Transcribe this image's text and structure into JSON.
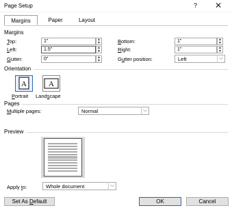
{
  "window": {
    "title": "Page Setup",
    "help": "?",
    "close": "✕"
  },
  "tabs": [
    {
      "label": "Margins",
      "accel": ""
    },
    {
      "label": "Paper"
    },
    {
      "label": "Layout"
    }
  ],
  "margins": {
    "section": "Margins",
    "top": {
      "pre": "",
      "key": "T",
      "post": "op:",
      "value": "1\""
    },
    "bottom": {
      "pre": "",
      "key": "B",
      "post": "ottom:",
      "value": "1\""
    },
    "left": {
      "pre": "",
      "key": "L",
      "post": "eft:",
      "value": "1.5\""
    },
    "right": {
      "pre": "",
      "key": "R",
      "post": "ight:",
      "value": "1\""
    },
    "gutter": {
      "pre": "",
      "key": "G",
      "post": "utter:",
      "value": "0\""
    },
    "gutter_position": {
      "pre": "G",
      "key": "u",
      "post": "tter position:",
      "value": "Left"
    }
  },
  "orientation": {
    "section": "Orientation",
    "portrait": {
      "pre": "",
      "key": "P",
      "post": "ortrait"
    },
    "landscape": {
      "pre": "Land",
      "key": "s",
      "post": "cape"
    }
  },
  "pages": {
    "section": "Pages",
    "multiple": {
      "pre": "",
      "key": "M",
      "post": "ultiple pages:",
      "value": "Normal"
    }
  },
  "preview": {
    "section": "Preview"
  },
  "apply": {
    "pre": "Apply ",
    "key": "t",
    "post": "o:",
    "value": "Whole document"
  },
  "footer": {
    "default_pre": "Set As ",
    "default_key": "D",
    "default_post": "efault",
    "ok": "OK",
    "cancel": "Cancel"
  },
  "icons": {
    "spin": "spin-up-down-icon",
    "dropdown": "chevron-down-icon"
  },
  "colors": {
    "selection": "#2a63b8",
    "button": "#e1e1e1"
  }
}
